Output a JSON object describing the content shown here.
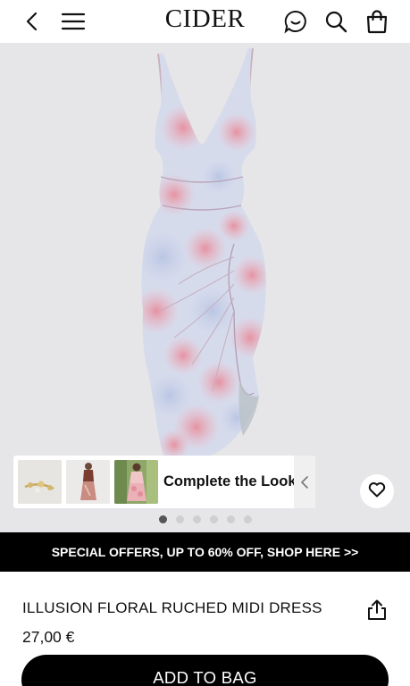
{
  "header": {
    "logo": "CIDER",
    "icons": [
      "back-arrow-icon",
      "menu-icon",
      "chat-icon",
      "search-icon",
      "bag-icon"
    ]
  },
  "gallery": {
    "dots_total": 6,
    "active_dot": 0
  },
  "complete_look": {
    "label": "Complete the Look",
    "thumbnails": [
      "earrings-thumbnail",
      "outfit-thumbnail",
      "dress-thumbnail"
    ]
  },
  "promo": {
    "text": "SPECIAL OFFERS, UP TO 60% OFF, SHOP HERE >>"
  },
  "product": {
    "title": "ILLUSION FLORAL RUCHED MIDI DRESS",
    "price": "27,00 €"
  },
  "actions": {
    "add_to_bag": "ADD TO BAG"
  },
  "colors": {
    "accent": "#000000",
    "hero_bg": "#e6e6e8",
    "dress_blue": "#c8d2e8",
    "dress_pink": "#eba7b4"
  }
}
